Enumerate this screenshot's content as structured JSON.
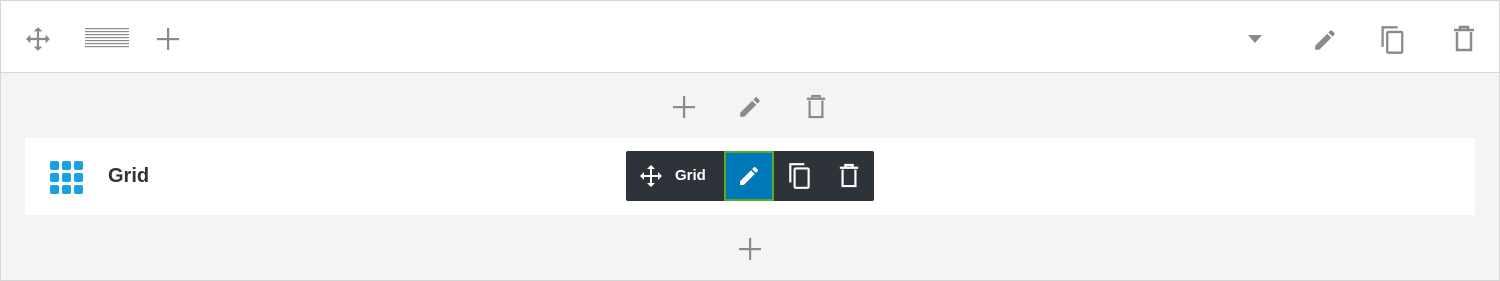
{
  "row": {
    "actions": [
      "move",
      "layout",
      "add-column"
    ],
    "right_actions": [
      "dropdown",
      "edit",
      "duplicate",
      "delete"
    ]
  },
  "column": {
    "actions": [
      "add",
      "edit",
      "delete"
    ]
  },
  "module": {
    "label": "Grid",
    "icon_color": "#1aa1e1",
    "toolbar": {
      "label": "Grid",
      "background": "#2d3338",
      "active_color": "#0079b8"
    }
  },
  "icons": {
    "move": "move-arrows-icon",
    "layout": "layout-lines-icon",
    "add": "plus-icon",
    "dropdown": "caret-down-icon",
    "edit": "pencil-icon",
    "duplicate": "copy-icon",
    "delete": "trash-icon",
    "grid": "grid-icon"
  },
  "colors": {
    "icon_gray": "#8a8a8a",
    "panel_bg": "#f4f4f4",
    "border": "#d6d6d6"
  }
}
